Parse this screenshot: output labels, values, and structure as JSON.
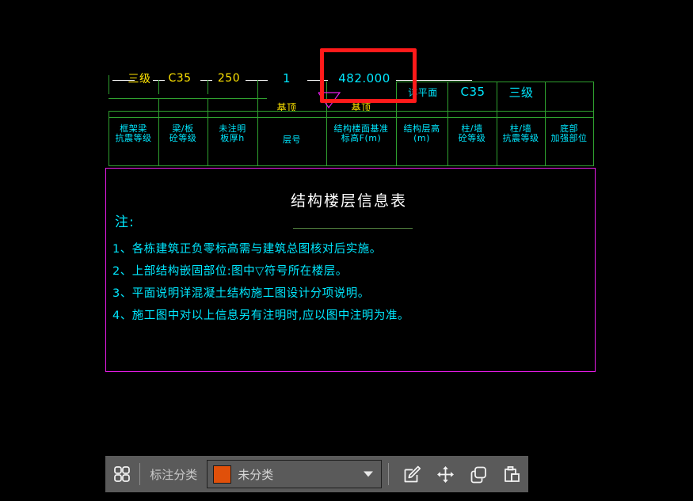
{
  "drawing": {
    "annotation_row": {
      "leader_values": [
        {
          "text": "三级",
          "color": "#ffe400"
        },
        {
          "text": "C35",
          "color": "#ffe400"
        },
        {
          "text": "250",
          "color": "#ffe400"
        },
        {
          "text": "1",
          "color": "#00e8ff"
        },
        {
          "text": "482.000",
          "color": "#00e8ff"
        }
      ],
      "sub_values": [
        {
          "text": "基顶",
          "color": "#ffe400"
        },
        {
          "text": "基顶",
          "color": "#ffe400"
        }
      ],
      "right_values": [
        {
          "text": "详平面",
          "color": "#00e8ff"
        },
        {
          "text": "C35",
          "color": "#00e8ff"
        },
        {
          "text": "三级",
          "color": "#00e8ff"
        }
      ]
    },
    "table_headers": [
      "框架梁\n抗震等级",
      "梁/板\n砼等级",
      "未注明\n板厚h",
      "层号",
      "结构楼面基准\n标高F(m)",
      "结构层高\n(m)",
      "柱/墙\n砼等级",
      "柱/墙\n抗震等级",
      "底部\n加强部位"
    ],
    "notes": {
      "title": "结构楼层信息表",
      "label": "注:",
      "lines": [
        "1、各栋建筑正负零标高需与建筑总图核对后实施。",
        "2、上部结构嵌固部位:图中▽符号所在楼层。",
        "3、平面说明详混凝土结构施工图设计分项说明。",
        "4、施工图中对以上信息另有注明时,应以图中注明为准。"
      ]
    },
    "colors": {
      "grid": "#2fa12f",
      "leader": "#ffffff",
      "notes_border": "#e81ce8",
      "highlight": "#ff1a1a",
      "marker": "#e81ce8",
      "header_text": "#00e8ff",
      "value_yellow": "#ffe400"
    }
  },
  "toolbar": {
    "grid_icon": "grid-icon",
    "category_label": "标注分类",
    "selected_category": "未分类",
    "selected_color": "#e0500a",
    "tools": [
      {
        "name": "edit-icon",
        "title": "编辑"
      },
      {
        "name": "move-icon",
        "title": "移动"
      },
      {
        "name": "copy-icon",
        "title": "复制"
      },
      {
        "name": "paste-icon",
        "title": "粘贴"
      }
    ]
  }
}
